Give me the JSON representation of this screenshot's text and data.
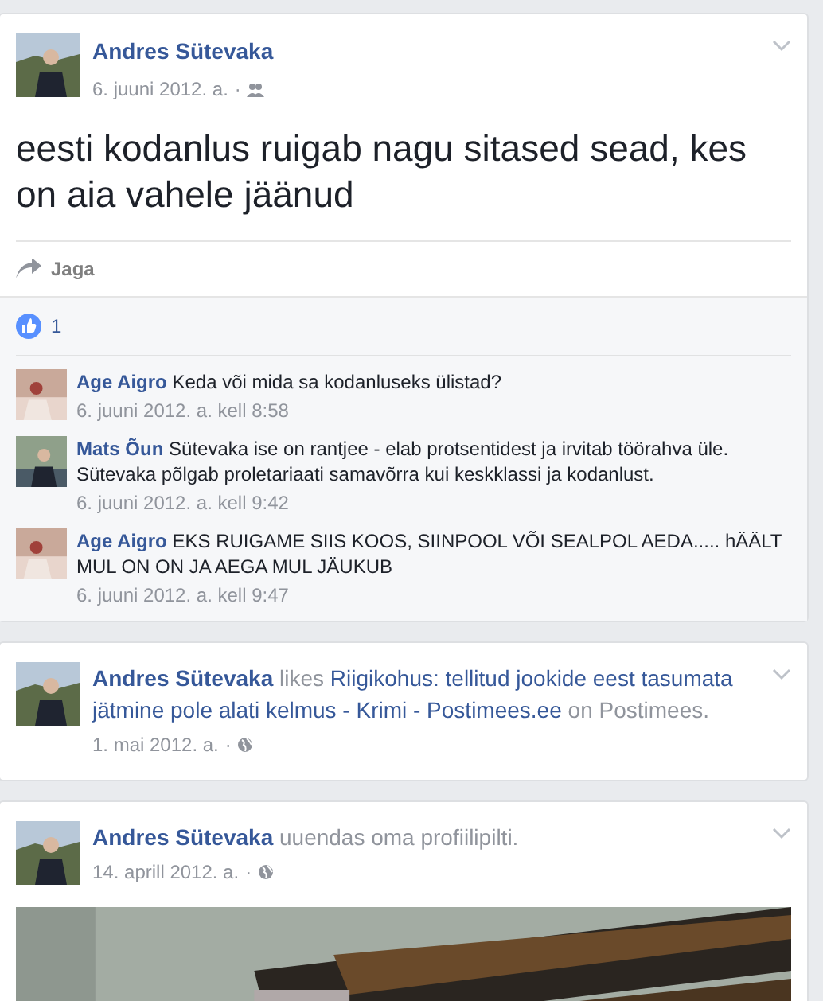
{
  "posts": [
    {
      "kind": "status",
      "author": "Andres Sütevaka",
      "date": "6. juuni 2012. a.",
      "separator": "·",
      "audience": {
        "kind": "friends"
      },
      "text": "eesti kodanlus ruigab nagu sitased sead, kes on aia vahele jäänud",
      "share_label": "Jaga",
      "like_count": "1",
      "comments": [
        {
          "author": "Age Aigro",
          "text": "Keda või mida sa kodanluseks ülistad?",
          "time": "6. juuni 2012. a. kell 8:58"
        },
        {
          "author": "Mats Õun",
          "text": "Sütevaka ise on rantjee - elab protsentidest ja irvitab töörahva üle. Sütevaka põlgab proletariaati samavõrra kui keskklassi ja kodanlust.",
          "time": "6. juuni 2012. a. kell 9:42"
        },
        {
          "author": "Age Aigro",
          "text": "EKS RUIGAME SIIS KOOS, SIINPOOL VÕI SEALPOL AEDA..... hÄÄLT MUL ON ON JA AEGA MUL JÄUKUB",
          "time": "6. juuni 2012. a. kell 9:47"
        }
      ]
    },
    {
      "kind": "like",
      "author": "Andres Sütevaka",
      "verb": "likes",
      "link": "Riigikohus: tellitud jookide eest tasumata jätmine pole alati kelmus - Krimi - Postimees.ee",
      "suffix": "on Postimees.",
      "date": "1. mai 2012. a.",
      "separator": "·",
      "audience": {
        "kind": "public"
      }
    },
    {
      "kind": "profile_photo",
      "author": "Andres Sütevaka",
      "verb": "uuendas oma profiilipilti.",
      "date": "14. aprill 2012. a.",
      "separator": "·",
      "audience": {
        "kind": "public"
      }
    }
  ]
}
